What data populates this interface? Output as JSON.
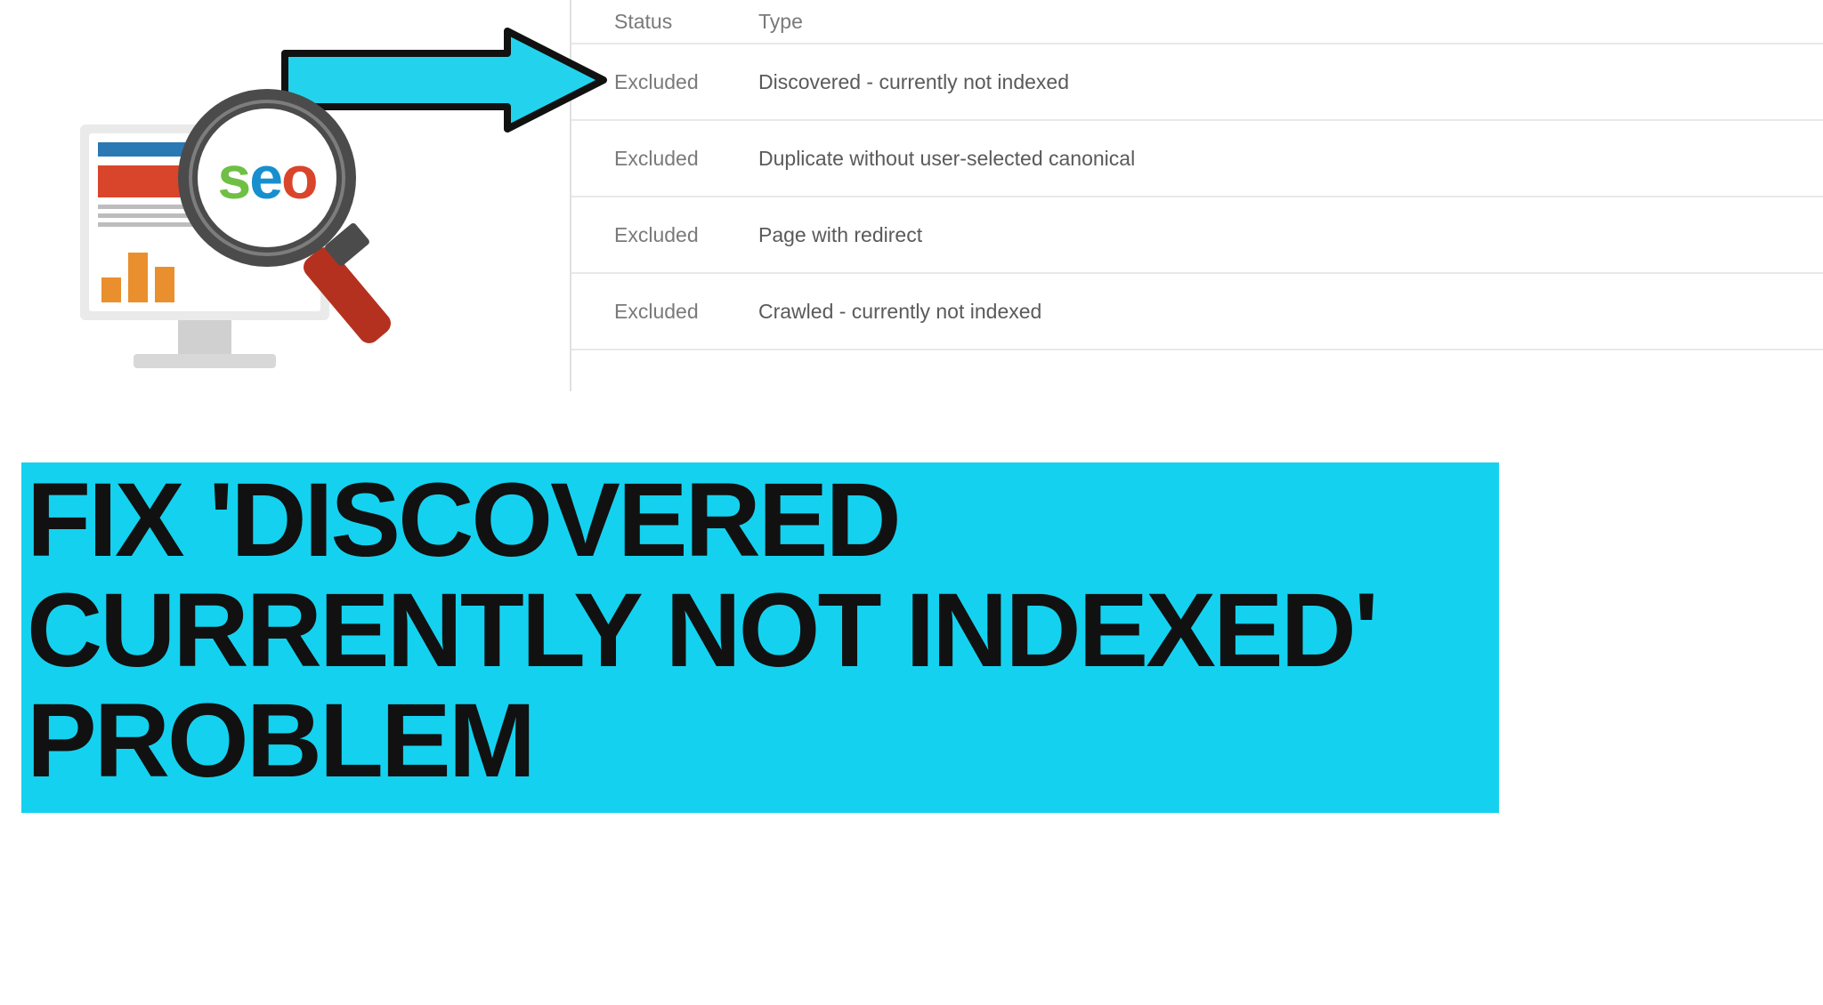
{
  "panel": {
    "header": {
      "status": "Status",
      "type": "Type"
    },
    "rows": [
      {
        "status": "Excluded",
        "type": "Discovered - currently not indexed"
      },
      {
        "status": "Excluded",
        "type": "Duplicate without user-selected canonical"
      },
      {
        "status": "Excluded",
        "type": "Page with redirect"
      },
      {
        "status": "Excluded",
        "type": "Crawled - currently not indexed"
      }
    ]
  },
  "illustration": {
    "seo_s": "s",
    "seo_e": "e",
    "seo_o": "o"
  },
  "banner": {
    "headline": "FIX 'DISCOVERED CURRENTLY NOT INDEXED' PROBLEM"
  },
  "colors": {
    "accent_cyan": "#14d2ef",
    "arrow_cyan": "#23d3ee"
  }
}
